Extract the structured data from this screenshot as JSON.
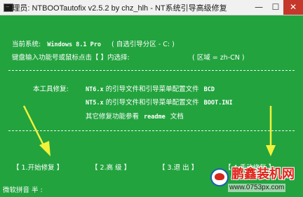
{
  "window": {
    "title": "管理员:  NTBOOTautofix v2.5.2 by chz_hlh - NT系统引导高级修复",
    "controls": {
      "minimize": "—",
      "maximize": "☐",
      "close": "✕"
    }
  },
  "console": {
    "system_label": "当前系统:",
    "system_value": "Windows 8.1 Pro",
    "auto_partition": "( 自选引导分区 - C: )",
    "prompt": "键盘输入功能号或鼠标点击【 】内选择:",
    "region": "( 区域 = zh-CN )",
    "features_title": "本工具修复:",
    "feature1_ver": "NT6.x",
    "feature1_text": "的引导文件和引导菜单配置文件",
    "feature1_file": "BCD",
    "feature2_ver": "NT5.x",
    "feature2_text": "的引导文件和引导菜单配置文件",
    "feature2_file": "BOOT.INI",
    "feature3_text": "其它修复功能参看",
    "feature3_file": "readme",
    "feature3_suffix": "文档",
    "ime_status": "微软拼音 半 :"
  },
  "menu": {
    "items": [
      {
        "label": "【 1.开始修复 】"
      },
      {
        "label": "【 2.高  级 】"
      },
      {
        "label": "【 3.退  出 】"
      },
      {
        "label": "【 4.手动修复 】"
      }
    ]
  },
  "watermark": {
    "title": "鹏鑫装机网",
    "url": "www.0753px.com"
  },
  "colors": {
    "console_bg": "#22a33e",
    "text": "#ffffff",
    "arrow": "#f2f23a",
    "close_button": "#c6372b"
  }
}
